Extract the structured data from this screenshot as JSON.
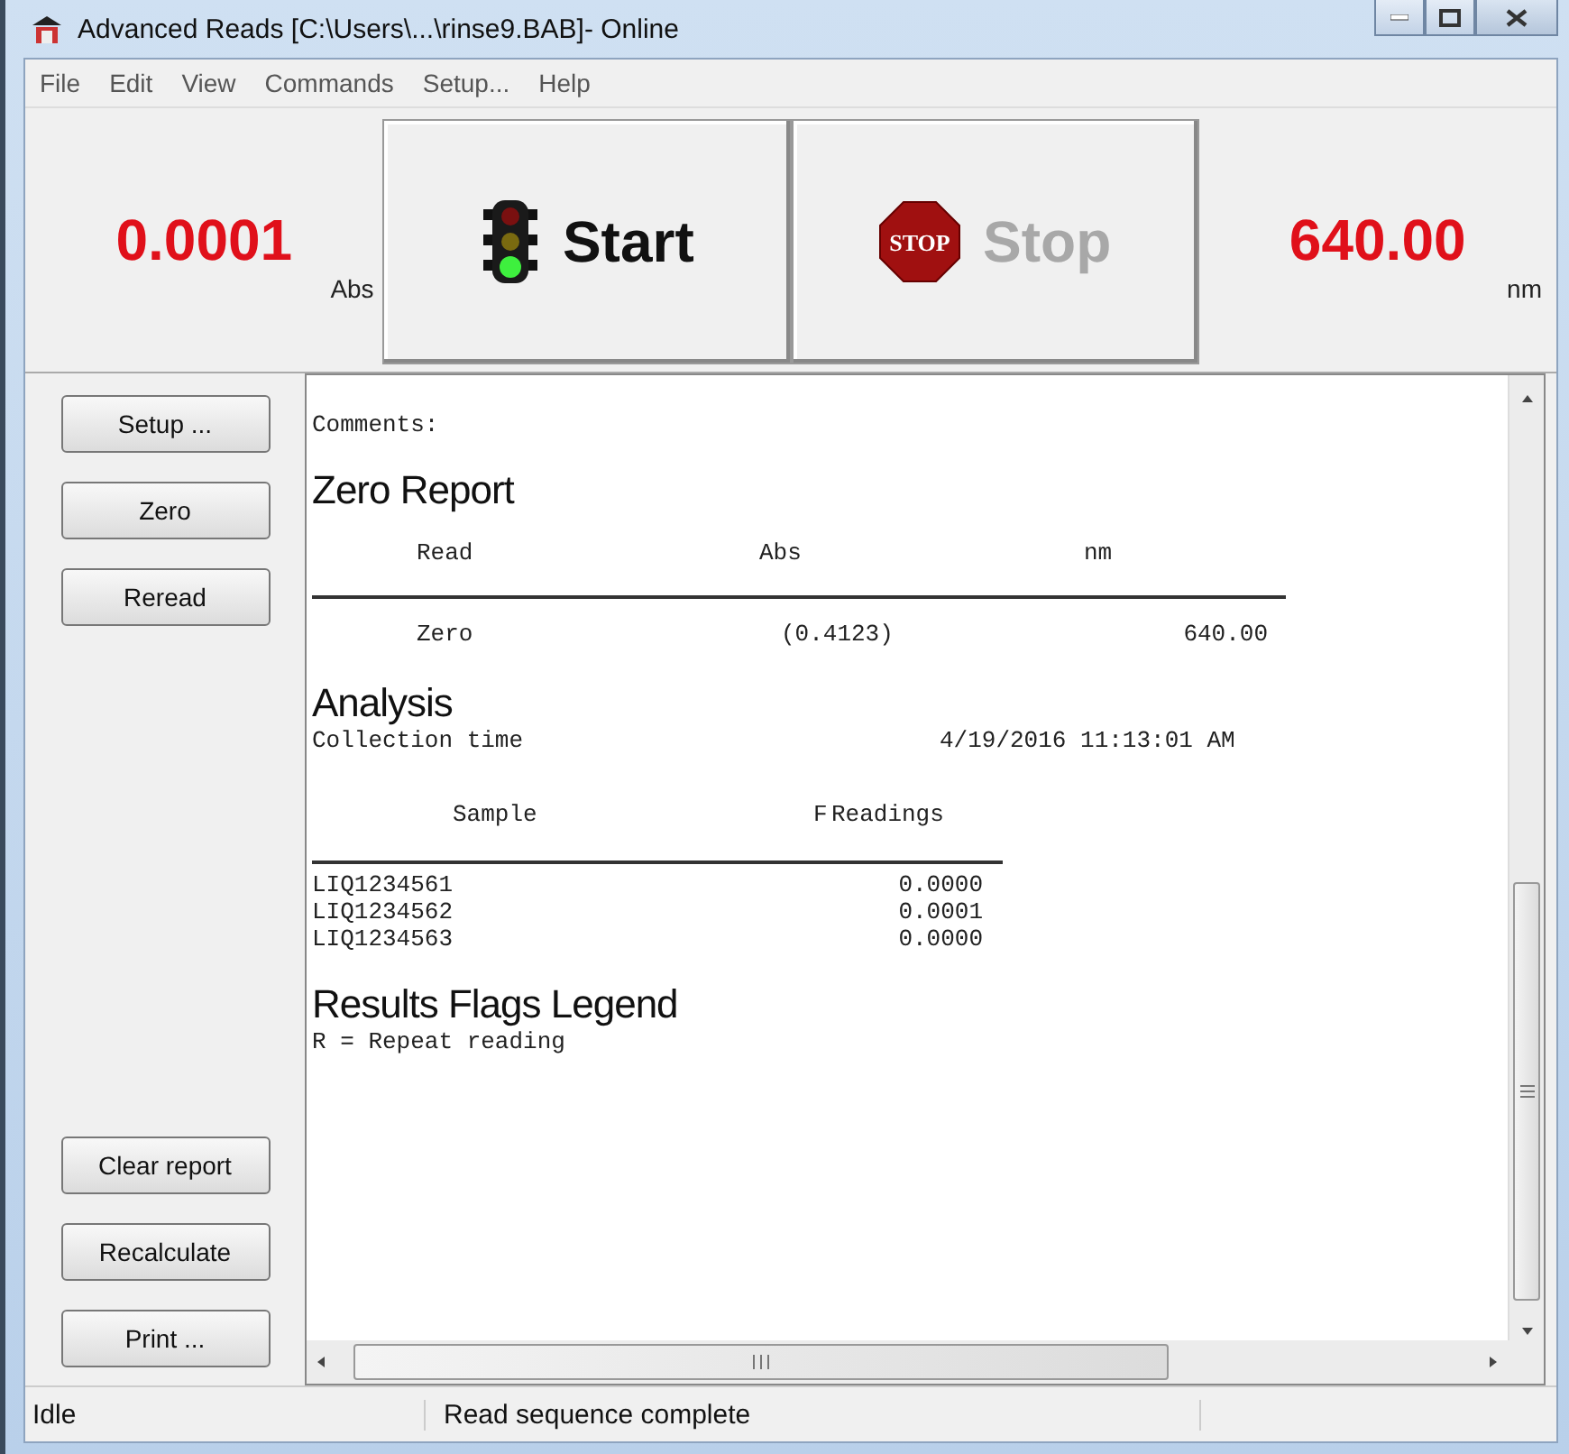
{
  "window": {
    "title": "Advanced Reads [C:\\Users\\...\\rinse9.BAB]- Online"
  },
  "menu": [
    "File",
    "Edit",
    "View",
    "Commands",
    "Setup...",
    "Help"
  ],
  "readout_abs": {
    "value": "0.0001",
    "unit": "Abs"
  },
  "buttons": [
    {
      "kind": "start",
      "label": "Start",
      "disabled": false
    },
    {
      "kind": "stop",
      "label": "Stop",
      "disabled": true,
      "sign_text": "STOP"
    }
  ],
  "readout_nm": {
    "value": "640.00",
    "unit": "nm"
  },
  "side_buttons_top": [
    "Setup ...",
    "Zero",
    "Reread"
  ],
  "side_buttons_bottom": [
    "Clear report",
    "Recalculate",
    "Print ..."
  ],
  "report": {
    "comments": "Comments:",
    "zero_title": "Zero Report",
    "zero_columns": [
      "Read",
      "Abs",
      "nm"
    ],
    "zero_rows": [
      [
        "Zero",
        "(0.4123)",
        "640.00"
      ]
    ],
    "analysis_title": "Analysis",
    "collection_label": "Collection time",
    "collection_value": "4/19/2016 11:13:01 AM",
    "sample_columns": [
      "Sample",
      "F",
      "Readings"
    ],
    "sample_rows": [
      [
        "LIQ1234561",
        "0.0000"
      ],
      [
        "LIQ1234562",
        "0.0001"
      ],
      [
        "LIQ1234563",
        "0.0000"
      ]
    ],
    "legend_title": "Results Flags Legend",
    "legend_lines": [
      "R = Repeat reading"
    ]
  },
  "status_bar": [
    "Idle",
    "Read sequence complete"
  ]
}
